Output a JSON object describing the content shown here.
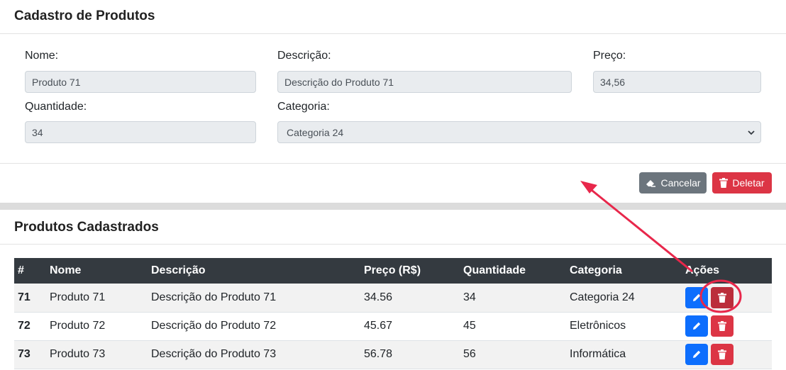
{
  "form": {
    "title": "Cadastro de Produtos",
    "nome_label": "Nome:",
    "nome_value": "Produto 71",
    "descricao_label": "Descrição:",
    "descricao_value": "Descrição do Produto 71",
    "preco_label": "Preço:",
    "preco_value": "34,56",
    "quantidade_label": "Quantidade:",
    "quantidade_value": "34",
    "categoria_label": "Categoria:",
    "categoria_value": "Categoria 24",
    "cancel_label": "Cancelar",
    "delete_label": "Deletar",
    "cancel_icon": "eraser-icon",
    "delete_icon": "trash-icon"
  },
  "list": {
    "title": "Produtos Cadastrados",
    "headers": [
      "#",
      "Nome",
      "Descrição",
      "Preço (R$)",
      "Quantidade",
      "Categoria",
      "Ações"
    ],
    "rows": [
      {
        "id": "71",
        "nome": "Produto 71",
        "descricao": "Descrição do Produto 71",
        "preco": "34.56",
        "quantidade": "34",
        "categoria": "Categoria 24"
      },
      {
        "id": "72",
        "nome": "Produto 72",
        "descricao": "Descrição do Produto 72",
        "preco": "45.67",
        "quantidade": "45",
        "categoria": "Eletrônicos"
      },
      {
        "id": "73",
        "nome": "Produto 73",
        "descricao": "Descrição do Produto 73",
        "preco": "56.78",
        "quantidade": "56",
        "categoria": "Informática"
      }
    ],
    "edit_icon": "pencil-icon",
    "delete_icon": "trash-icon"
  },
  "colors": {
    "primary": "#0d6efd",
    "danger": "#dc3545",
    "secondary": "#6c757d",
    "table_header": "#343a40",
    "annotation": "#e8274b"
  }
}
